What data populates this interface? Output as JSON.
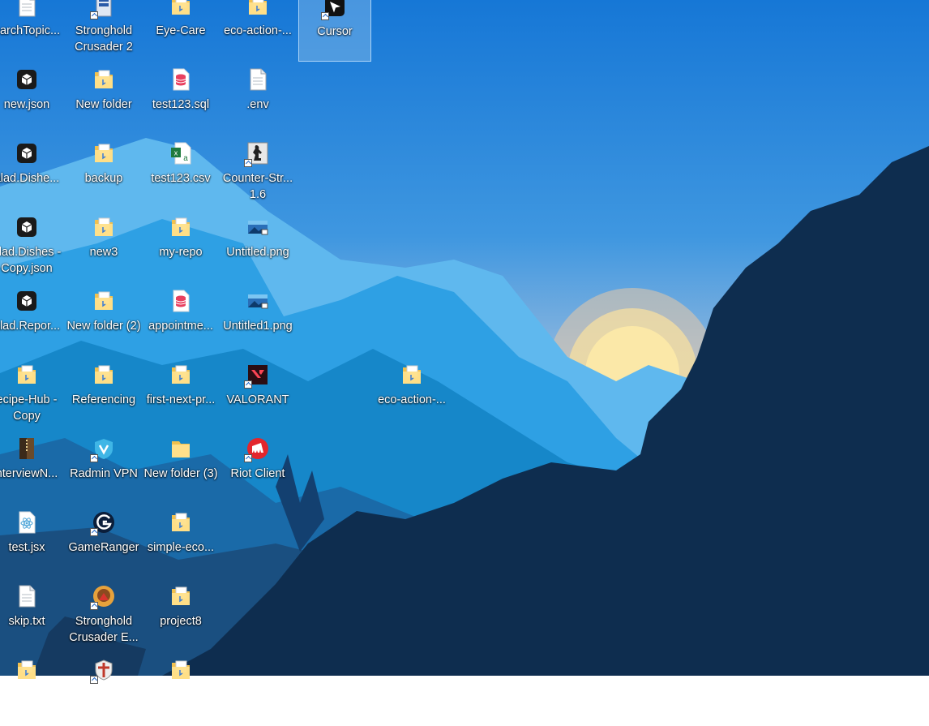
{
  "desktop": {
    "icons": [
      {
        "id": "searchtopic",
        "label": "earchTopic...",
        "type": "doc"
      },
      {
        "id": "stronghold-crusader-2",
        "label": "Stronghold Crusader 2",
        "type": "app-blue"
      },
      {
        "id": "eye-care",
        "label": "Eye-Care",
        "type": "folder-doc"
      },
      {
        "id": "eco-action-1",
        "label": "eco-action-...",
        "type": "folder-doc"
      },
      {
        "id": "cursor",
        "label": "Cursor",
        "type": "cursor",
        "selected": true
      },
      {
        "id": "new-json",
        "label": "new.json",
        "type": "cube"
      },
      {
        "id": "new-folder",
        "label": "New folder",
        "type": "folder-doc"
      },
      {
        "id": "test123-sql",
        "label": "test123.sql",
        "type": "sql"
      },
      {
        "id": "env",
        "label": ".env",
        "type": "doc"
      },
      {
        "id": "salad-dishes",
        "label": "alad.Dishe...",
        "type": "cube"
      },
      {
        "id": "backup",
        "label": "backup",
        "type": "folder-doc"
      },
      {
        "id": "test123-csv",
        "label": "test123.csv",
        "type": "csv"
      },
      {
        "id": "counter-strike",
        "label": "Counter-Str... 1.6",
        "type": "cs"
      },
      {
        "id": "salad-dishes-copy",
        "label": "alad.Dishes - Copy.json",
        "type": "cube"
      },
      {
        "id": "new3",
        "label": "new3",
        "type": "folder-doc"
      },
      {
        "id": "my-repo",
        "label": "my-repo",
        "type": "folder-doc"
      },
      {
        "id": "untitled-png",
        "label": "Untitled.png",
        "type": "image"
      },
      {
        "id": "salad-report",
        "label": "alad.Repor...",
        "type": "cube"
      },
      {
        "id": "new-folder-2",
        "label": "New folder (2)",
        "type": "folder-doc"
      },
      {
        "id": "appointme",
        "label": "appointme...",
        "type": "sql"
      },
      {
        "id": "untitled1-png",
        "label": "Untitled1.png",
        "type": "image"
      },
      {
        "id": "recipe-hub-copy",
        "label": "ecipe-Hub - Copy",
        "type": "folder-doc"
      },
      {
        "id": "referencing",
        "label": "Referencing",
        "type": "folder-doc"
      },
      {
        "id": "first-next-pr",
        "label": "first-next-pr...",
        "type": "folder-doc"
      },
      {
        "id": "valorant",
        "label": "VALORANT",
        "type": "valorant"
      },
      {
        "id": "eco-action-2",
        "label": "eco-action-...",
        "type": "folder-doc"
      },
      {
        "id": "interviewn",
        "label": "nterviewN...",
        "type": "archive"
      },
      {
        "id": "radmin-vpn",
        "label": "Radmin VPN",
        "type": "radmin"
      },
      {
        "id": "new-folder-3",
        "label": "New folder (3)",
        "type": "folder"
      },
      {
        "id": "riot-client",
        "label": "Riot Client",
        "type": "riot"
      },
      {
        "id": "test-jsx",
        "label": "test.jsx",
        "type": "react"
      },
      {
        "id": "gameranger",
        "label": "GameRanger",
        "type": "gameranger"
      },
      {
        "id": "simple-eco",
        "label": "simple-eco...",
        "type": "folder-doc"
      },
      {
        "id": "skip-txt",
        "label": "skip.txt",
        "type": "doc"
      },
      {
        "id": "stronghold-crusader-e",
        "label": "Stronghold Crusader E...",
        "type": "stronghold"
      },
      {
        "id": "project8",
        "label": "project8",
        "type": "folder-doc"
      },
      {
        "id": "partial-1",
        "label": "",
        "type": "folder-doc"
      },
      {
        "id": "partial-2",
        "label": "",
        "type": "shield"
      },
      {
        "id": "partial-3",
        "label": "",
        "type": "folder-doc"
      }
    ]
  },
  "colors": {
    "folder": "#f2c14e",
    "folder_light": "#ffe08a",
    "sql": "#e8405f",
    "csv": "#1f7a3e",
    "cube": "#1a1a1a",
    "valorant": "#fa4454",
    "riot": "#e3262d",
    "radmin": "#3fb6e6",
    "react": "#4fa6d8"
  }
}
